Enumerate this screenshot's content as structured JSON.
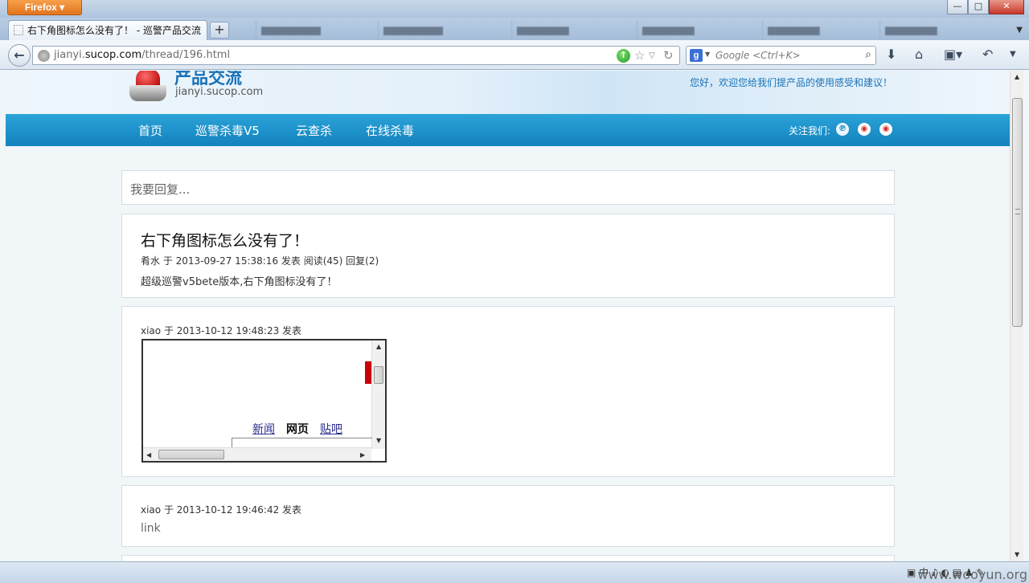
{
  "browser": {
    "menu_label": "Firefox",
    "window_buttons": {
      "minimize": "—",
      "maximize": "□",
      "close": "✕"
    },
    "active_tab_title": "右下角图标怎么没有了！ - 巡警产品交流",
    "new_tab": "+",
    "url_prefix": "jianyi.",
    "url_domain": "sucop.com",
    "url_path": "/thread/196.html",
    "search_placeholder": "Google <Ctrl+K>",
    "search_engine": "g"
  },
  "header": {
    "site_title": "产品交流",
    "site_domain": "jianyi.sucop.com",
    "welcome": "您好，欢迎您给我们提产品的使用感受和建议！"
  },
  "nav": {
    "items": [
      "首页",
      "巡警杀毒V5",
      "云查杀",
      "在线杀毒"
    ],
    "follow_label": "关注我们:"
  },
  "reply_box": {
    "placeholder": "我要回复..."
  },
  "post": {
    "title": "右下角图标怎么没有了！",
    "meta": "肴水 于 2013-09-27 15:38:16 发表 阅读(45) 回复(2)",
    "body": "超级巡警v5bete版本,右下角图标没有了！"
  },
  "replies": [
    {
      "meta": "xiao 于 2013-10-12 19:48:23 发表",
      "embedded_links": [
        "新闻",
        "网页",
        "贴吧"
      ]
    },
    {
      "meta": "xiao 于 2013-10-12 19:46:42 发表",
      "text": "link"
    }
  ],
  "statusbar": {
    "tray_text": "中",
    "watermark": "www.wooyun.org"
  }
}
